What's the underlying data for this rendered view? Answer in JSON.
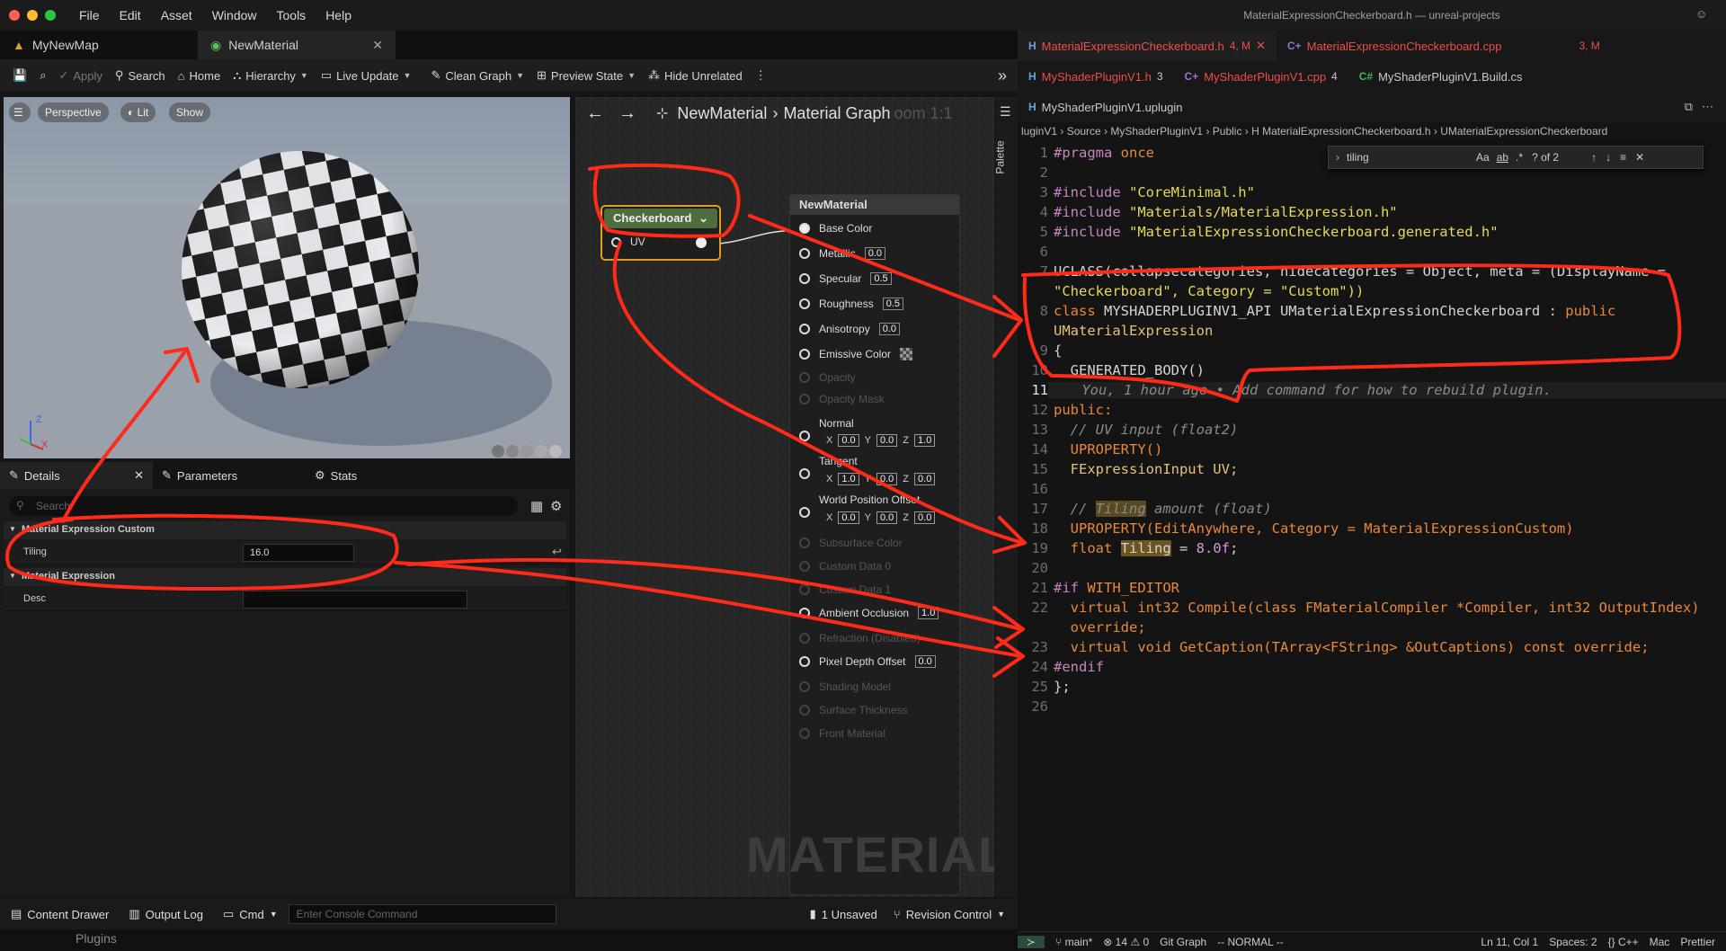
{
  "ue": {
    "menu": [
      "File",
      "Edit",
      "Asset",
      "Window",
      "Tools",
      "Help"
    ],
    "tabs": [
      {
        "label": "MyNewMap"
      },
      {
        "label": "NewMaterial"
      }
    ],
    "toolbar": {
      "apply": "Apply",
      "search": "Search",
      "home": "Home",
      "hierarchy": "Hierarchy",
      "live_update": "Live Update",
      "clean_graph": "Clean Graph",
      "preview_state": "Preview State",
      "hide_unrelated": "Hide Unrelated"
    },
    "viewport": {
      "perspective": "Perspective",
      "lit": "Lit",
      "show": "Show"
    },
    "details": {
      "tabs": {
        "details": "Details",
        "parameters": "Parameters",
        "stats": "Stats"
      },
      "search_placeholder": "Search",
      "section1": "Material Expression Custom",
      "tiling_label": "Tiling",
      "tiling_value": "16.0",
      "section2": "Material Expression",
      "desc_label": "Desc",
      "desc_value": ""
    },
    "graph": {
      "breadcrumb_root": "NewMaterial",
      "breadcrumb_leaf": "Material Graph",
      "zoom": "oom 1:1",
      "palette": "Palette",
      "checker_node": {
        "title": "Checkerboard",
        "pin": "UV"
      },
      "material_node": {
        "title": "NewMaterial",
        "base_color": "Base Color",
        "metallic": "Metallic",
        "metallic_v": "0.0",
        "specular": "Specular",
        "specular_v": "0.5",
        "roughness": "Roughness",
        "roughness_v": "0.5",
        "anisotropy": "Anisotropy",
        "anisotropy_v": "0.0",
        "emissive": "Emissive Color",
        "opacity": "Opacity",
        "opacity_mask": "Opacity Mask",
        "normal": "Normal",
        "tangent": "Tangent",
        "wpo": "World Position Offset",
        "x": "X",
        "y": "Y",
        "z": "Z",
        "normal_v": [
          "0.0",
          "0.0",
          "1.0"
        ],
        "tangent_v": [
          "1.0",
          "0.0",
          "0.0"
        ],
        "wpo_v": [
          "0.0",
          "0.0",
          "0.0"
        ],
        "subsurface": "Subsurface Color",
        "cd0": "Custom Data 0",
        "cd1": "Custom Data 1",
        "ao": "Ambient Occlusion",
        "ao_v": "1.0",
        "refraction": "Refraction (Disabled)",
        "pdo": "Pixel Depth Offset",
        "pdo_v": "0.0",
        "shading": "Shading Model",
        "surface_thickness": "Surface Thickness",
        "front_material": "Front Material"
      },
      "watermark": "MATERIAL"
    },
    "bottom": {
      "content_drawer": "Content Drawer",
      "output_log": "Output Log",
      "cmd": "Cmd",
      "console_placeholder": "Enter Console Command",
      "unsaved": "1 Unsaved",
      "revision": "Revision Control"
    },
    "plugins": "Plugins"
  },
  "vs": {
    "title": "MaterialExpressionCheckerboard.h — unreal-projects",
    "tabs_row1": [
      {
        "icon": "H",
        "label": "MaterialExpressionCheckerboard.h",
        "count": "4, M"
      },
      {
        "icon": "C+",
        "label": "MaterialExpressionCheckerboard.cpp",
        "count": "3, M"
      }
    ],
    "tabs_row2": [
      {
        "icon": "H",
        "label": "MyShaderPluginV1.h",
        "count": "3"
      },
      {
        "icon": "C+",
        "label": "MyShaderPluginV1.cpp",
        "count": "4"
      },
      {
        "icon": "C#",
        "label": "MyShaderPluginV1.Build.cs",
        "count": ""
      }
    ],
    "tabs_row3": [
      {
        "icon": "H",
        "label": "MyShaderPluginV1.uplugin"
      }
    ],
    "breadcrumb": "luginV1 › Source › MyShaderPluginV1 › Public › H MaterialExpressionCheckerboard.h › UMaterialExpressionCheckerboard",
    "find": {
      "query": "tiling",
      "result": "? of 2",
      "aa": "Aa",
      "ab": "ab",
      "re": ".*"
    },
    "lines": [
      {
        "n": "1"
      },
      {
        "n": "2"
      },
      {
        "n": "3"
      },
      {
        "n": "4"
      },
      {
        "n": "5"
      },
      {
        "n": "6"
      },
      {
        "n": "7"
      },
      {
        "n": ""
      },
      {
        "n": "8"
      },
      {
        "n": ""
      },
      {
        "n": "9"
      },
      {
        "n": "10"
      },
      {
        "n": "11"
      },
      {
        "n": "12"
      },
      {
        "n": "13"
      },
      {
        "n": "14"
      },
      {
        "n": "15"
      },
      {
        "n": "16"
      },
      {
        "n": "17"
      },
      {
        "n": "18"
      },
      {
        "n": "19"
      },
      {
        "n": "20"
      },
      {
        "n": "21"
      },
      {
        "n": "22"
      },
      {
        "n": ""
      },
      {
        "n": "23"
      },
      {
        "n": "24"
      },
      {
        "n": "25"
      },
      {
        "n": "26"
      }
    ],
    "code": {
      "l1a": "#pragma",
      "l1b": " once",
      "inc": "#include",
      "l3": " \"CoreMinimal.h\"",
      "l4": " \"Materials/MaterialExpression.h\"",
      "l5": " \"MaterialExpressionCheckerboard.generated.h\"",
      "l7": "UCLASS(collapsecategories, hidecategories = Object, meta = (DisplayName =",
      "l7b": "\"Checkerboard\", Category = \"Custom\"))",
      "l8a": "class",
      "l8b": " MYSHADERPLUGINV1_API UMaterialExpressionCheckerboard : ",
      "l8c": "public",
      "l8d": "UMaterialExpression",
      "l9": "{",
      "l10": "  GENERATED_BODY()",
      "l11": "    You, 1 hour ago • Add command for how to rebuild plugin.",
      "l12": "public:",
      "l13": "  // UV input (float2)",
      "l14": "  UPROPERTY()",
      "l15": "  FExpressionInput UV;",
      "l17a": "  // ",
      "l17b": "Tiling",
      "l17c": " amount (float)",
      "l18": "  UPROPERTY(EditAnywhere, Category = MaterialExpressionCustom)",
      "l19a": "  float ",
      "l19b": "Tiling",
      "l19c": " = ",
      "l19d": "8.0f",
      ";": ";",
      "l21a": "#if",
      "l21b": " WITH_EDITOR",
      "l22": "  virtual int32 Compile(class FMaterialCompiler *Compiler, int32 OutputIndex)",
      "l22b": "  override;",
      "l23": "  virtual void GetCaption(TArray<FString> &OutCaptions) const override;",
      "l24": "#endif",
      "l25": "};"
    },
    "status": {
      "branch": "main*",
      "errors": "⊗ 14 ⚠ 0",
      "git_graph": "Git Graph",
      "mode": "-- NORMAL --",
      "position": "Ln 11, Col 1",
      "spaces": "Spaces: 2",
      "lang": "{} C++",
      "os": "Mac",
      "prettier": "Prettier"
    }
  },
  "colors": {
    "annotation": "#ff2a1a",
    "node_orange": "#e39b21",
    "tab_red": "#f14c4c"
  }
}
